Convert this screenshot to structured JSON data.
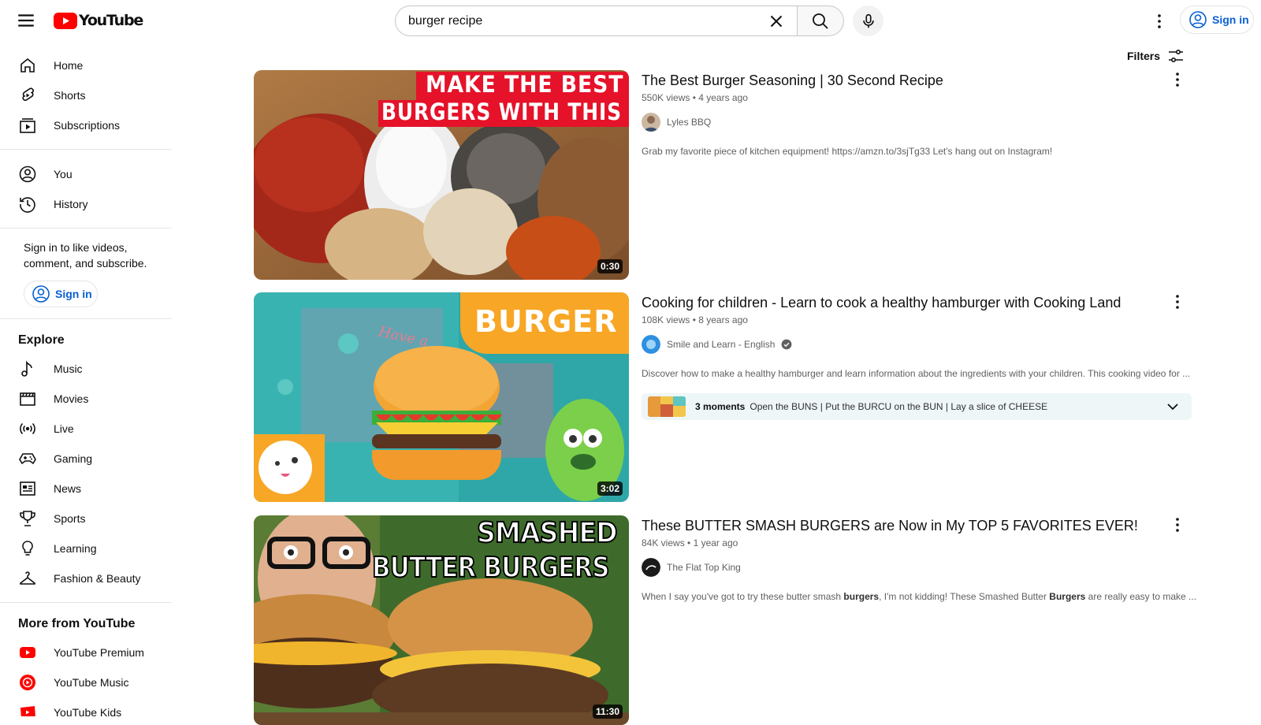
{
  "header": {
    "logo_text": "YouTube",
    "search_value": "burger recipe",
    "sign_in": "Sign in"
  },
  "sidebar": {
    "primary": [
      {
        "label": "Home",
        "icon": "home-icon"
      },
      {
        "label": "Shorts",
        "icon": "shorts-icon"
      },
      {
        "label": "Subscriptions",
        "icon": "subscriptions-icon"
      }
    ],
    "you": [
      {
        "label": "You",
        "icon": "you-icon"
      },
      {
        "label": "History",
        "icon": "history-icon"
      }
    ],
    "signin_note": "Sign in to like videos, comment, and subscribe.",
    "sign_in": "Sign in",
    "explore_title": "Explore",
    "explore": [
      {
        "label": "Music",
        "icon": "music-icon"
      },
      {
        "label": "Movies",
        "icon": "movies-icon"
      },
      {
        "label": "Live",
        "icon": "live-icon"
      },
      {
        "label": "Gaming",
        "icon": "gaming-icon"
      },
      {
        "label": "News",
        "icon": "news-icon"
      },
      {
        "label": "Sports",
        "icon": "sports-icon"
      },
      {
        "label": "Learning",
        "icon": "learning-icon"
      },
      {
        "label": "Fashion & Beauty",
        "icon": "fashion-icon"
      }
    ],
    "more_title": "More from YouTube",
    "more": [
      {
        "label": "YouTube Premium",
        "icon": "youtube-premium-icon"
      },
      {
        "label": "YouTube Music",
        "icon": "youtube-music-icon"
      },
      {
        "label": "YouTube Kids",
        "icon": "youtube-kids-icon"
      }
    ]
  },
  "filters_label": "Filters",
  "results": [
    {
      "title": "The Best Burger Seasoning | 30 Second Recipe",
      "views": "550K views",
      "age": "4 years ago",
      "channel": "Lyles BBQ",
      "verified": false,
      "description": "Grab my favorite piece of kitchen equipment! https://amzn.to/3sjTg33 Let's hang out on Instagram!",
      "duration": "0:30",
      "thumb_text_1": "MAKE THE BEST",
      "thumb_text_2": "BURGERS WITH THIS"
    },
    {
      "title": "Cooking for children - Learn to cook a healthy hamburger with Cooking Land",
      "views": "108K views",
      "age": "8 years ago",
      "channel": "Smile and Learn - English",
      "verified": true,
      "description": "Discover how to make a healthy hamburger and learn information about the ingredients with your children. This cooking video for ...",
      "duration": "3:02",
      "thumb_text_1": "BURGER",
      "thumb_text_2": "Have a",
      "moments_count": "3 moments",
      "moments_text": "Open the BUNS | Put the BURCU on the BUN | Lay a slice of CHEESE"
    },
    {
      "title": "These BUTTER SMASH BURGERS are Now in My TOP 5 FAVORITES EVER!",
      "views": "84K views",
      "age": "1 year ago",
      "channel": "The Flat Top King",
      "verified": false,
      "description_parts": [
        "When I say you've got to try these butter smash ",
        "burgers",
        ", I'm not kidding! These Smashed Butter ",
        "Burgers",
        " are really easy to make ..."
      ],
      "duration": "11:30",
      "thumb_text_1": "SMASHED",
      "thumb_text_2": "BUTTER BURGERS"
    }
  ],
  "colors": {
    "brand_red": "#ff0000",
    "link_blue": "#065fd4",
    "text_secondary": "#606060"
  }
}
